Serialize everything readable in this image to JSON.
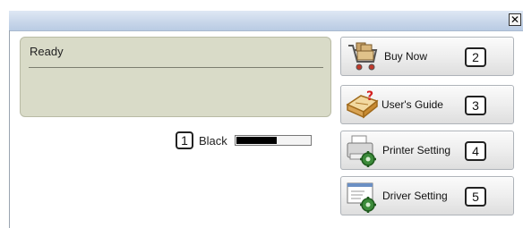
{
  "window": {
    "close_glyph": "✕"
  },
  "status": {
    "text": "Ready"
  },
  "toner": {
    "number": "1",
    "label": "Black",
    "level_fraction": 0.55,
    "fill_color": "#000000"
  },
  "buttons": [
    {
      "label": "Buy Now",
      "number": "2",
      "icon": "shopping-cart-icon"
    },
    {
      "label": "User's Guide",
      "number": "3",
      "icon": "help-book-icon"
    },
    {
      "label": "Printer Setting",
      "number": "4",
      "icon": "printer-gear-icon"
    },
    {
      "label": "Driver Setting",
      "number": "5",
      "icon": "driver-gear-icon"
    }
  ],
  "colors": {
    "status_panel": "#d9dbc8",
    "titlebar": "#c9d7ea"
  }
}
